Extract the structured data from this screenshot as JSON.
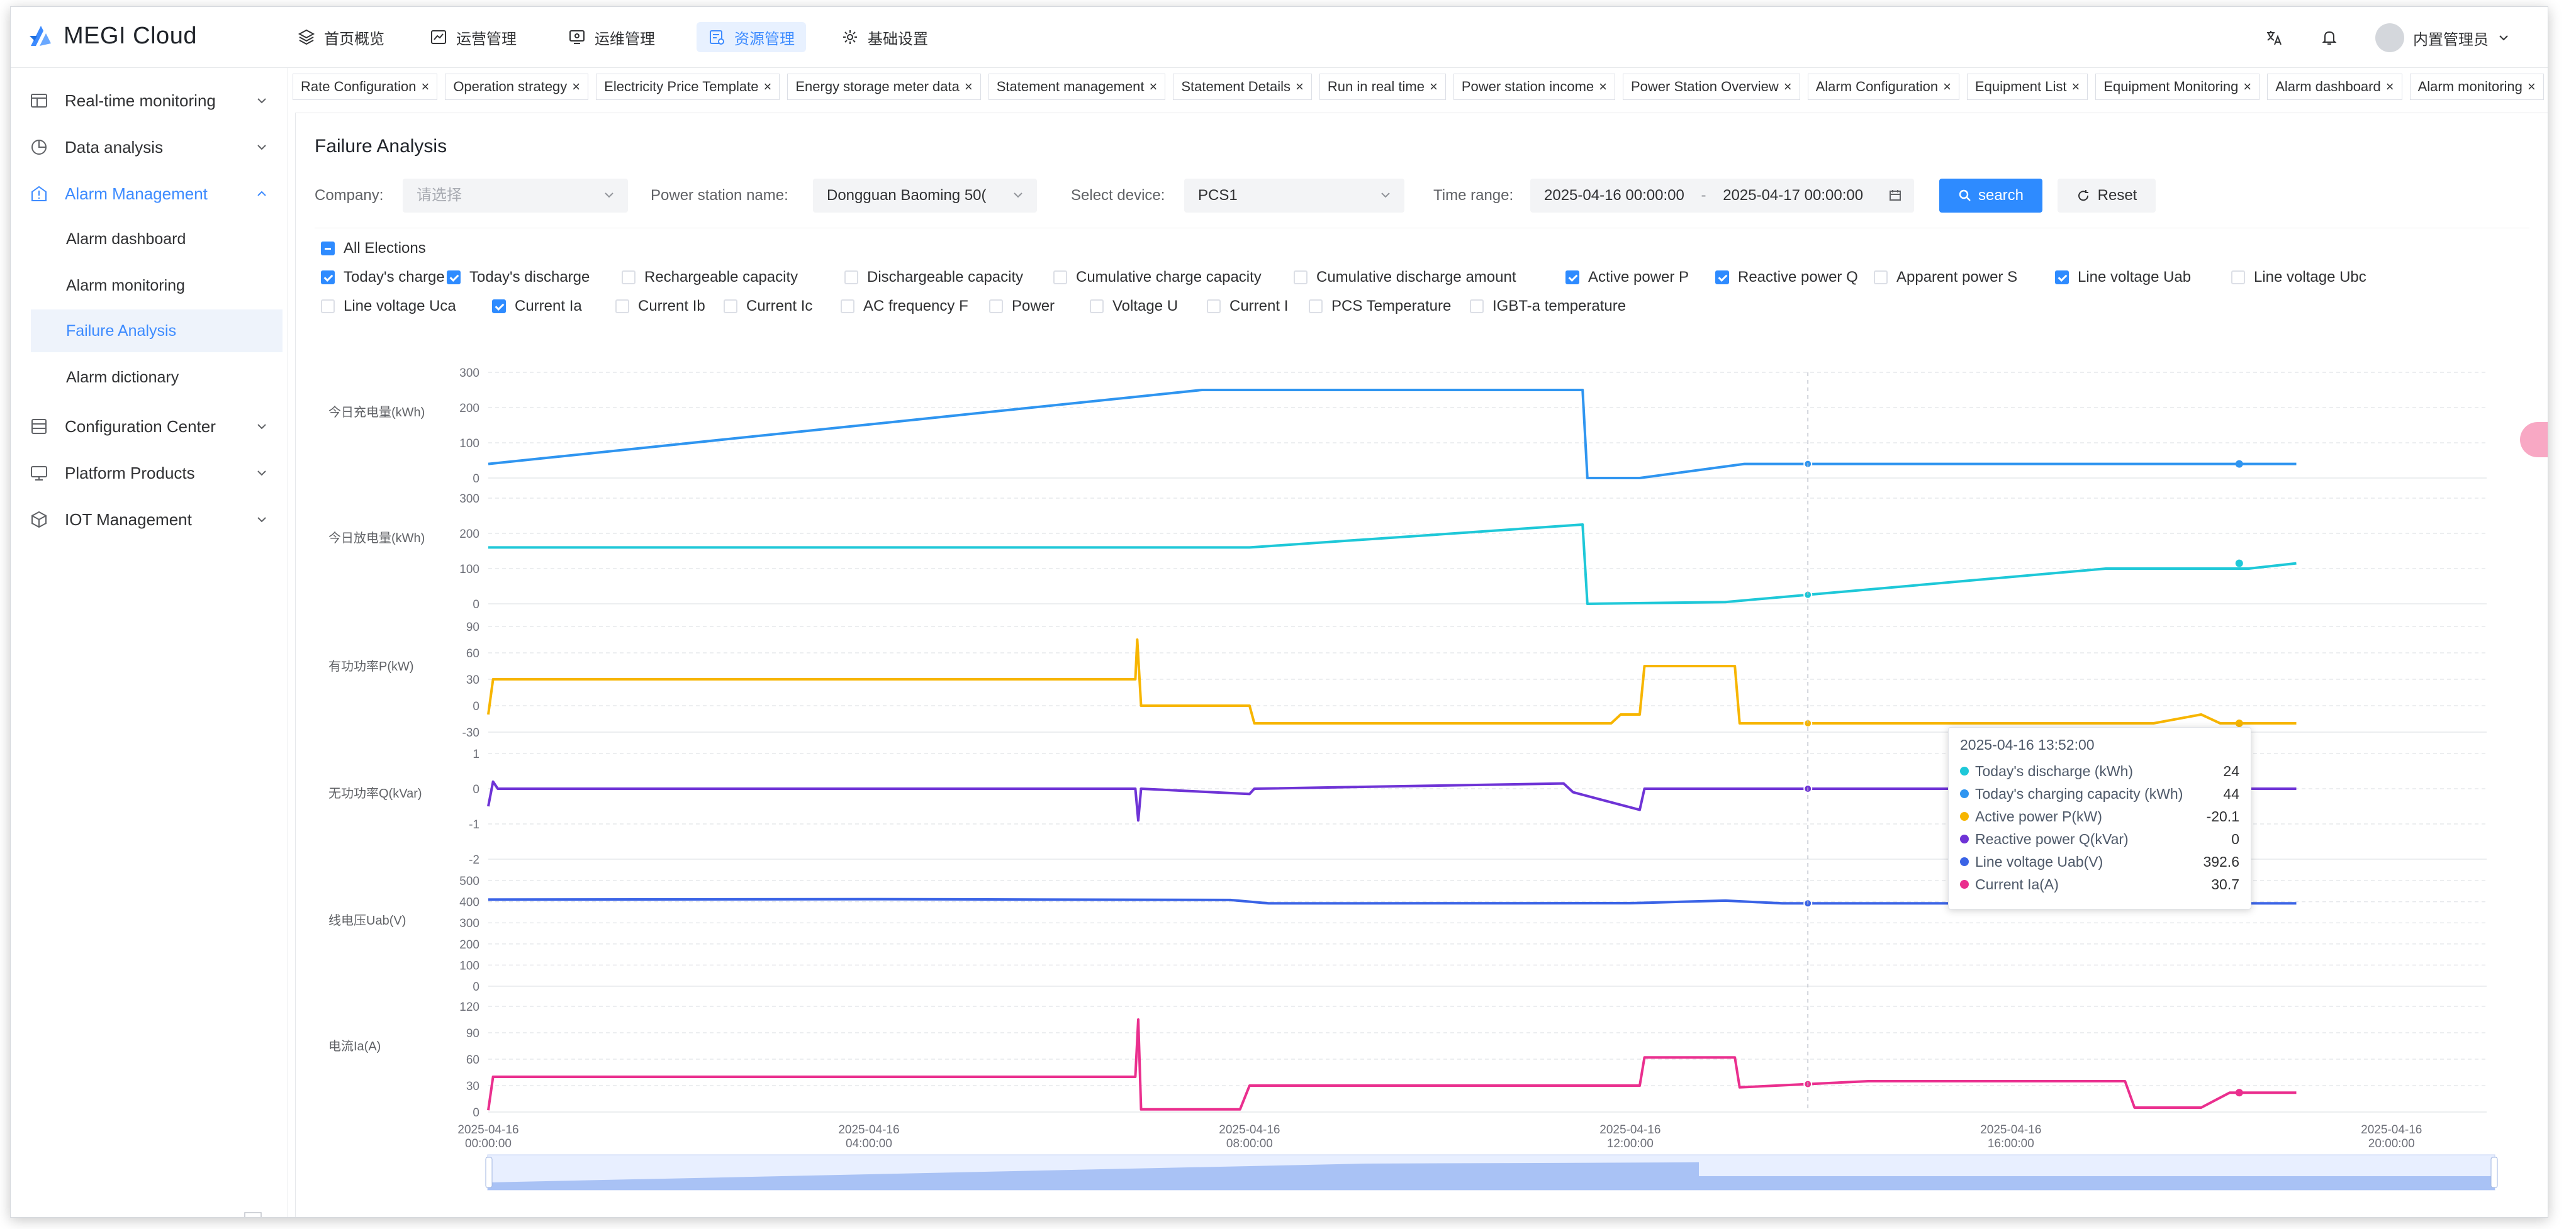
{
  "app": {
    "name": "MEGI Cloud"
  },
  "topnav": [
    {
      "label": "首页概览",
      "icon": "layers-icon"
    },
    {
      "label": "运营管理",
      "icon": "chart-box-icon"
    },
    {
      "label": "运维管理",
      "icon": "monitor-icon"
    },
    {
      "label": "资源管理",
      "icon": "resource-icon",
      "active": true
    },
    {
      "label": "基础设置",
      "icon": "gear-icon"
    }
  ],
  "user": {
    "name": "内置管理员"
  },
  "sidebar": {
    "items": [
      {
        "label": "Real-time monitoring"
      },
      {
        "label": "Data analysis"
      },
      {
        "label": "Alarm Management",
        "open": true
      },
      {
        "label": "Configuration Center"
      },
      {
        "label": "Platform Products"
      },
      {
        "label": "IOT Management"
      }
    ],
    "subitems": [
      {
        "label": "Alarm dashboard"
      },
      {
        "label": "Alarm monitoring"
      },
      {
        "label": "Failure Analysis",
        "active": true
      },
      {
        "label": "Alarm dictionary"
      }
    ]
  },
  "tabs": [
    "Rate Configuration",
    "Operation strategy",
    "Electricity Price Template",
    "Energy storage meter data",
    "Statement management",
    "Statement Details",
    "Run in real time",
    "Power station income",
    "Power Station Overview",
    "Alarm Configuration",
    "Equipment List",
    "Equipment Monitoring",
    "Alarm dashboard",
    "Alarm monitoring"
  ],
  "page": {
    "title": "Failure Analysis"
  },
  "filters": {
    "company_label": "Company:",
    "company_placeholder": "请选择",
    "station_label": "Power station name:",
    "station_value": "Dongguan Baoming 50(",
    "device_label": "Select device:",
    "device_value": "PCS1",
    "time_label": "Time range:",
    "time_start": "2025-04-16 00:00:00",
    "time_sep": "-",
    "time_end": "2025-04-17 00:00:00",
    "search_label": "search",
    "reset_label": "Reset"
  },
  "checkboxes": {
    "all_label": "All Elections",
    "items": [
      {
        "label": "Today's charge",
        "checked": true
      },
      {
        "label": "Today's discharge",
        "checked": true
      },
      {
        "label": "Rechargeable capacity",
        "checked": false
      },
      {
        "label": "Dischargeable capacity",
        "checked": false
      },
      {
        "label": "Cumulative charge capacity",
        "checked": false
      },
      {
        "label": "Cumulative discharge amount",
        "checked": false
      },
      {
        "label": "Active power P",
        "checked": true
      },
      {
        "label": "Reactive power Q",
        "checked": true
      },
      {
        "label": "Apparent power S",
        "checked": false
      },
      {
        "label": "Line voltage Uab",
        "checked": true
      },
      {
        "label": "Line voltage Ubc",
        "checked": false
      },
      {
        "label": "Line voltage Uca",
        "checked": false
      },
      {
        "label": "Current Ia",
        "checked": true
      },
      {
        "label": "Current Ib",
        "checked": false
      },
      {
        "label": "Current Ic",
        "checked": false
      },
      {
        "label": "AC frequency F",
        "checked": false
      },
      {
        "label": "Power",
        "checked": false
      },
      {
        "label": "Voltage U",
        "checked": false
      },
      {
        "label": "Current I",
        "checked": false
      },
      {
        "label": "PCS Temperature",
        "checked": false
      },
      {
        "label": "IGBT-a temperature",
        "checked": false
      }
    ]
  },
  "tooltip": {
    "time": "2025-04-16 13:52:00",
    "rows": [
      {
        "label": "Today's discharge (kWh)",
        "value": "24",
        "color": "#1ec8d8"
      },
      {
        "label": "Today's charging capacity (kWh)",
        "value": "44",
        "color": "#2f95f0"
      },
      {
        "label": "Active power P(kW)",
        "value": "-20.1",
        "color": "#f7b500"
      },
      {
        "label": "Reactive power Q(kVar)",
        "value": "0",
        "color": "#6e33d6"
      },
      {
        "label": "Line voltage Uab(V)",
        "value": "392.6",
        "color": "#3a63e6"
      },
      {
        "label": "Current Ia(A)",
        "value": "30.7",
        "color": "#ea2f8e"
      }
    ]
  },
  "chart_data": {
    "type": "line",
    "x_unit": "time",
    "x_range": [
      "2025-04-16 00:00",
      "2025-04-16 21:00"
    ],
    "x_ticks": [
      {
        "t": 0,
        "date": "2025-04-16",
        "time": "00:00:00"
      },
      {
        "t": 4,
        "date": "2025-04-16",
        "time": "04:00:00"
      },
      {
        "t": 8,
        "date": "2025-04-16",
        "time": "08:00:00"
      },
      {
        "t": 12,
        "date": "2025-04-16",
        "time": "12:00:00"
      },
      {
        "t": 16,
        "date": "2025-04-16",
        "time": "16:00:00"
      },
      {
        "t": 20,
        "date": "2025-04-16",
        "time": "20:00:00"
      }
    ],
    "cursor_time": 13.867,
    "panels": [
      {
        "ylabel": "今日充电量(kWh)",
        "color": "#2f95f0",
        "ylim": [
          0,
          300
        ],
        "yticks": [
          0,
          100,
          200,
          300
        ],
        "points": [
          [
            0,
            40
          ],
          [
            7.5,
            250
          ],
          [
            11.5,
            250
          ],
          [
            11.55,
            0
          ],
          [
            12.1,
            0
          ],
          [
            13.2,
            40
          ],
          [
            19,
            40
          ]
        ]
      },
      {
        "ylabel": "今日放电量(kWh)",
        "color": "#1ec8d8",
        "ylim": [
          0,
          300
        ],
        "yticks": [
          0,
          100,
          200,
          300
        ],
        "points": [
          [
            0,
            160
          ],
          [
            8,
            160
          ],
          [
            11.5,
            225
          ],
          [
            11.55,
            0
          ],
          [
            13.0,
            5
          ],
          [
            17,
            100
          ],
          [
            18.5,
            100
          ],
          [
            19,
            115
          ]
        ]
      },
      {
        "ylabel": "有功功率P(kW)",
        "color": "#f7b500",
        "ylim": [
          -30,
          90
        ],
        "yticks": [
          -30,
          0,
          30,
          60,
          90
        ],
        "points": [
          [
            0,
            -10
          ],
          [
            0.05,
            30
          ],
          [
            6.8,
            30
          ],
          [
            6.82,
            75
          ],
          [
            6.86,
            0
          ],
          [
            8,
            0
          ],
          [
            8.05,
            -20
          ],
          [
            11.8,
            -20
          ],
          [
            11.9,
            -10
          ],
          [
            12.1,
            -10
          ],
          [
            12.15,
            45
          ],
          [
            13.1,
            45
          ],
          [
            13.15,
            -20
          ],
          [
            17,
            -20
          ],
          [
            17.5,
            -20
          ],
          [
            18.0,
            -10
          ],
          [
            18.2,
            -20
          ],
          [
            19,
            -20
          ]
        ]
      },
      {
        "ylabel": "无功功率Q(kVar)",
        "color": "#6e33d6",
        "ylim": [
          -2,
          1
        ],
        "yticks": [
          -2,
          -1,
          0,
          1
        ],
        "points": [
          [
            0,
            -0.5
          ],
          [
            0.05,
            0.2
          ],
          [
            0.1,
            0
          ],
          [
            6.8,
            0
          ],
          [
            6.83,
            -0.9
          ],
          [
            6.86,
            0
          ],
          [
            8.0,
            -0.15
          ],
          [
            8.05,
            0
          ],
          [
            11.3,
            0.15
          ],
          [
            11.4,
            -0.1
          ],
          [
            12.1,
            -0.6
          ],
          [
            12.15,
            0
          ],
          [
            19,
            0
          ]
        ]
      },
      {
        "ylabel": "线电压Uab(V)",
        "color": "#3a63e6",
        "ylim": [
          0,
          500
        ],
        "yticks": [
          0,
          100,
          200,
          300,
          400,
          500
        ],
        "points": [
          [
            0,
            410
          ],
          [
            4,
            412
          ],
          [
            7.8,
            408
          ],
          [
            8.2,
            392
          ],
          [
            12,
            393
          ],
          [
            13,
            405
          ],
          [
            13.6,
            392
          ],
          [
            17,
            392
          ],
          [
            17.5,
            408
          ],
          [
            18.3,
            392
          ],
          [
            19,
            392
          ]
        ]
      },
      {
        "ylabel": "电流Ia(A)",
        "color": "#ea2f8e",
        "ylim": [
          0,
          120
        ],
        "yticks": [
          0,
          30,
          60,
          90,
          120
        ],
        "points": [
          [
            0,
            2
          ],
          [
            0.05,
            40
          ],
          [
            6.8,
            40
          ],
          [
            6.83,
            105
          ],
          [
            6.86,
            3
          ],
          [
            7.9,
            3
          ],
          [
            8,
            30
          ],
          [
            11.8,
            30
          ],
          [
            12.1,
            30
          ],
          [
            12.15,
            62
          ],
          [
            13.1,
            62
          ],
          [
            13.15,
            28
          ],
          [
            14.5,
            35
          ],
          [
            17.2,
            35
          ],
          [
            17.3,
            5
          ],
          [
            18,
            5
          ],
          [
            18.3,
            22
          ],
          [
            19,
            22
          ]
        ]
      }
    ]
  }
}
